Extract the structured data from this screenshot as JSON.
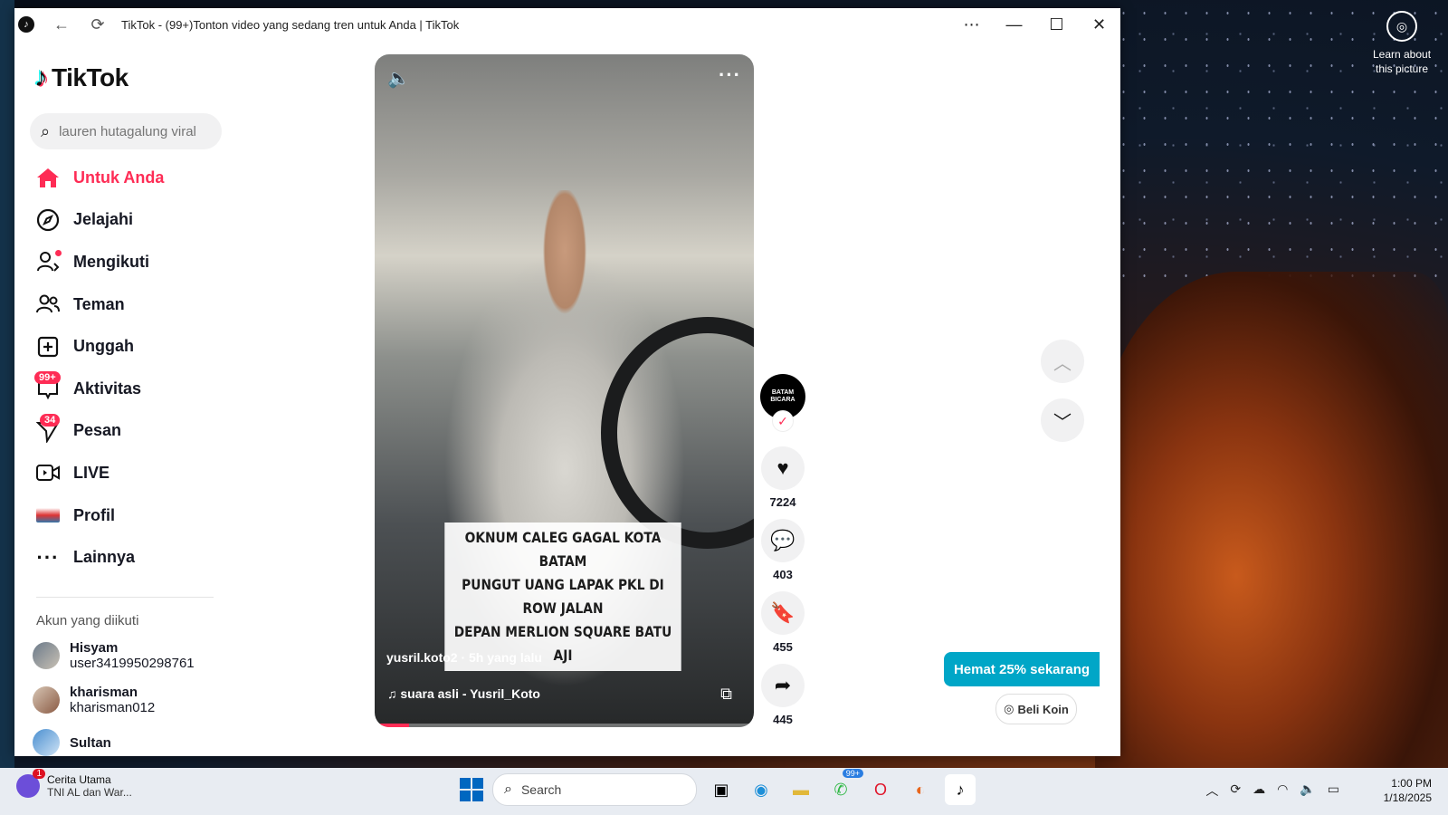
{
  "window": {
    "title": "TikTok - (99+)Tonton video yang sedang tren untuk Anda | TikTok"
  },
  "desktop": {
    "learn_line1": "Learn about",
    "learn_line2": "this picture"
  },
  "sidebar": {
    "logo_text": "TikTok",
    "search_placeholder": "lauren hutagalung viral",
    "nav": [
      {
        "label": "Untuk Anda",
        "icon": "home-icon",
        "active": true
      },
      {
        "label": "Jelajahi",
        "icon": "compass-icon"
      },
      {
        "label": "Mengikuti",
        "icon": "following-icon"
      },
      {
        "label": "Teman",
        "icon": "friends-icon"
      },
      {
        "label": "Unggah",
        "icon": "upload-icon"
      },
      {
        "label": "Aktivitas",
        "icon": "activity-icon",
        "badge": "99+"
      },
      {
        "label": "Pesan",
        "icon": "message-icon",
        "badge": "34"
      },
      {
        "label": "LIVE",
        "icon": "live-icon"
      },
      {
        "label": "Profil",
        "icon": "profile-avatar"
      },
      {
        "label": "Lainnya",
        "icon": "more-icon"
      }
    ],
    "following_title": "Akun yang diikuti",
    "accounts": [
      {
        "name": "Hisyam",
        "username": "user3419950298761"
      },
      {
        "name": "kharisman",
        "username": "kharisman012"
      },
      {
        "name": "Sultan",
        "username": ""
      }
    ]
  },
  "video": {
    "caption_lines": [
      "OKNUM CALEG GAGAL KOTA BATAM",
      "PUNGUT UANG LAPAK PKL DI ROW JALAN",
      "DEPAN MERLION SQUARE BATU AJI"
    ],
    "author_line": "yusril.koto2 · 5h yang lalu",
    "music": "suara asli - Yusril_Koto",
    "progress_fraction": 0.09
  },
  "actions": {
    "avatar_text": "BATAM BICARA",
    "likes": "7224",
    "comments": "403",
    "saves": "455",
    "shares": "445"
  },
  "promo": {
    "save_label": "Hemat 25% sekarang",
    "coin_label": "Beli Koin"
  },
  "taskbar": {
    "news_badge": "1",
    "news_title": "Cerita Utama",
    "news_sub": "TNI AL dan War...",
    "search_label": "Search",
    "whatsapp_badge": "99+",
    "time": "1:00 PM",
    "date": "1/18/2025"
  },
  "colors": {
    "accent": "#fe2c55",
    "promo": "#00a6c7"
  }
}
